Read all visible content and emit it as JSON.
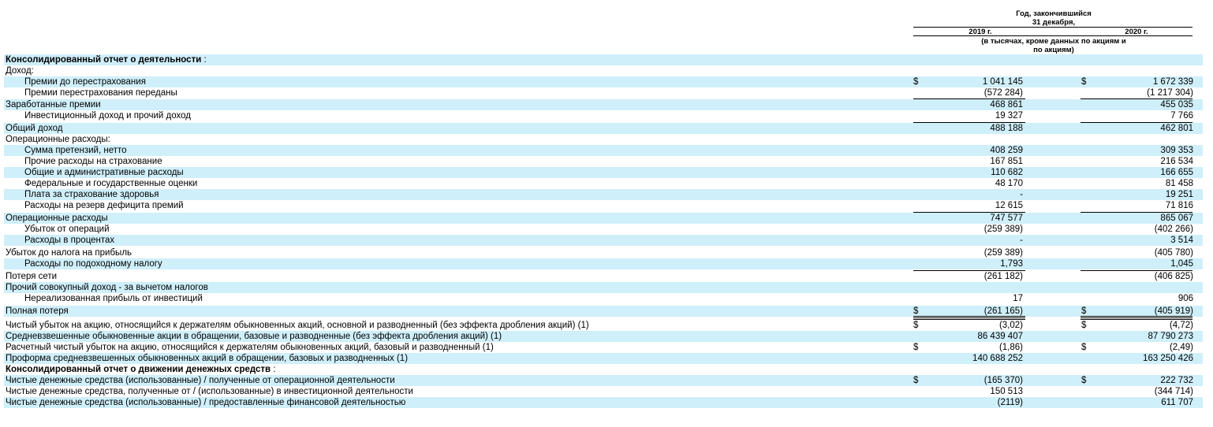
{
  "header": {
    "period_line1": "Год, закончившийся",
    "period_line2": "31 декабря,",
    "col1": "2019 г.",
    "col2": "2020 г.",
    "units_line1": "(в тысячах, кроме данных по акциям и",
    "units_line2": "по акциям)"
  },
  "rows": [
    {
      "label": "Консолидированный отчет о деятельности",
      "suffix": " :",
      "bold": true,
      "indent": false,
      "shaded": true,
      "d1": "",
      "v1": "",
      "d2": "",
      "v2": ""
    },
    {
      "label": "Доход:",
      "suffix": "",
      "bold": false,
      "indent": false,
      "shaded": false,
      "d1": "",
      "v1": "",
      "d2": "",
      "v2": ""
    },
    {
      "label": "Премии до перестрахования",
      "suffix": "",
      "bold": false,
      "indent": true,
      "shaded": true,
      "d1": "$",
      "v1": "1 041 145",
      "d2": "$",
      "v2": "1 672 339"
    },
    {
      "label": "Премии перестрахования переданы",
      "suffix": "",
      "bold": false,
      "indent": true,
      "shaded": false,
      "d1": "",
      "v1": "(572 284)",
      "d2": "",
      "v2": "(1 217 304)"
    },
    {
      "label": "Заработанные премии",
      "suffix": "",
      "bold": false,
      "indent": false,
      "shaded": true,
      "d1": "",
      "v1": "468 861",
      "d2": "",
      "v2": "455 035"
    },
    {
      "label": "Инвестиционный доход и прочий доход",
      "suffix": "",
      "bold": false,
      "indent": true,
      "shaded": false,
      "d1": "",
      "v1": "19 327",
      "d2": "",
      "v2": "7 766"
    },
    {
      "label": "Общий доход",
      "suffix": "",
      "bold": false,
      "indent": false,
      "shaded": true,
      "d1": "",
      "v1": "488 188",
      "d2": "",
      "v2": "462 801"
    },
    {
      "label": "Операционные расходы:",
      "suffix": "",
      "bold": false,
      "indent": false,
      "shaded": false,
      "d1": "",
      "v1": "",
      "d2": "",
      "v2": ""
    },
    {
      "label": "Сумма претензий, нетто",
      "suffix": "",
      "bold": false,
      "indent": true,
      "shaded": true,
      "d1": "",
      "v1": "408 259",
      "d2": "",
      "v2": "309 353"
    },
    {
      "label": "Прочие расходы на страхование",
      "suffix": "",
      "bold": false,
      "indent": true,
      "shaded": false,
      "d1": "",
      "v1": "167 851",
      "d2": "",
      "v2": "216 534"
    },
    {
      "label": "Общие и административные расходы",
      "suffix": "",
      "bold": false,
      "indent": true,
      "shaded": true,
      "d1": "",
      "v1": "110 682",
      "d2": "",
      "v2": "166 655"
    },
    {
      "label": "Федеральные и государственные оценки",
      "suffix": "",
      "bold": false,
      "indent": true,
      "shaded": false,
      "d1": "",
      "v1": "48 170",
      "d2": "",
      "v2": "81 458"
    },
    {
      "label": "Плата за страхование здоровья",
      "suffix": "",
      "bold": false,
      "indent": true,
      "shaded": true,
      "d1": "",
      "v1": "-",
      "d2": "",
      "v2": "19 251"
    },
    {
      "label": "Расходы на резерв дефицита премий",
      "suffix": "",
      "bold": false,
      "indent": true,
      "shaded": false,
      "d1": "",
      "v1": "12 615",
      "d2": "",
      "v2": "71 816"
    },
    {
      "label": "Операционные расходы",
      "suffix": "",
      "bold": false,
      "indent": false,
      "shaded": true,
      "d1": "",
      "v1": "747 577",
      "d2": "",
      "v2": "865 067"
    },
    {
      "label": "Убыток от операций",
      "suffix": "",
      "bold": false,
      "indent": true,
      "shaded": false,
      "d1": "",
      "v1": "(259 389)",
      "d2": "",
      "v2": "(402 266)"
    },
    {
      "label": "Расходы в процентах",
      "suffix": "",
      "bold": false,
      "indent": true,
      "shaded": true,
      "d1": "",
      "v1": "-",
      "d2": "",
      "v2": "3 514"
    },
    {
      "label": "Убыток до налога на прибыль",
      "suffix": "",
      "bold": false,
      "indent": false,
      "shaded": false,
      "d1": "",
      "v1": "(259 389)",
      "d2": "",
      "v2": "(405 780)"
    },
    {
      "label": "Расходы по подоходному налогу",
      "suffix": "",
      "bold": false,
      "indent": true,
      "shaded": true,
      "d1": "",
      "v1": "1,793",
      "d2": "",
      "v2": "1,045"
    },
    {
      "label": "Потеря сети",
      "suffix": "",
      "bold": false,
      "indent": false,
      "shaded": false,
      "d1": "",
      "v1": "(261 182)",
      "d2": "",
      "v2": "(406 825)"
    },
    {
      "label": "Прочий совокупный доход - за вычетом налогов",
      "suffix": "",
      "bold": false,
      "indent": false,
      "shaded": true,
      "d1": "",
      "v1": "",
      "d2": "",
      "v2": ""
    },
    {
      "label": "Нереализованная прибыль от инвестиций",
      "suffix": "",
      "bold": false,
      "indent": true,
      "shaded": false,
      "d1": "",
      "v1": "17",
      "d2": "",
      "v2": "906"
    },
    {
      "label": "Полная потеря",
      "suffix": "",
      "bold": false,
      "indent": false,
      "shaded": true,
      "d1": "$",
      "v1": "(261 165)",
      "d2": "$",
      "v2": "(405 919)"
    },
    {
      "label": "Чистый убыток на акцию, относящийся к держателям обыкновенных акций, основной и разводненный (без эффекта дробления акций) (1)",
      "suffix": "",
      "bold": false,
      "indent": false,
      "shaded": false,
      "d1": "$",
      "v1": "(3,02)",
      "d2": "$",
      "v2": "(4,72)"
    },
    {
      "label": "Средневзвешенные обыкновенные акции в обращении, базовые и разводненные (без эффекта дробления акций) (1)",
      "suffix": "",
      "bold": false,
      "indent": false,
      "shaded": true,
      "d1": "",
      "v1": "86 439 407",
      "d2": "",
      "v2": "87 790 273"
    },
    {
      "label": "Расчетный чистый убыток на акцию, относящийся к держателям обыкновенных акций, базовый и разводненный (1)",
      "suffix": "",
      "bold": false,
      "indent": false,
      "shaded": false,
      "d1": "$",
      "v1": "(1,86)",
      "d2": "$",
      "v2": "(2,49)"
    },
    {
      "label": "Проформа средневзвешенных обыкновенных акций в обращении, базовых и разводненных (1)",
      "suffix": "",
      "bold": false,
      "indent": false,
      "shaded": true,
      "d1": "",
      "v1": "140 688 252",
      "d2": "",
      "v2": "163 250 426"
    },
    {
      "label": "Консолидированный отчет о движении денежных средств",
      "suffix": " :",
      "bold": true,
      "indent": false,
      "shaded": false,
      "d1": "",
      "v1": "",
      "d2": "",
      "v2": ""
    },
    {
      "label": "Чистые денежные средства (использованные) / полученные от операционной деятельности",
      "suffix": "",
      "bold": false,
      "indent": false,
      "shaded": true,
      "d1": "$",
      "v1": "(165 370)",
      "d2": "$",
      "v2": "222 732"
    },
    {
      "label": "Чистые денежные средства, полученные от / (использованные) в инвестиционной деятельности",
      "suffix": "",
      "bold": false,
      "indent": false,
      "shaded": false,
      "d1": "",
      "v1": "150 513",
      "d2": "",
      "v2": "(344 714)"
    },
    {
      "label": "Чистые денежные средства (использованные) / предоставленные финансовой деятельностью",
      "suffix": "",
      "bold": false,
      "indent": false,
      "shaded": true,
      "d1": "",
      "v1": "(2119)",
      "d2": "",
      "v2": "611 707"
    }
  ]
}
